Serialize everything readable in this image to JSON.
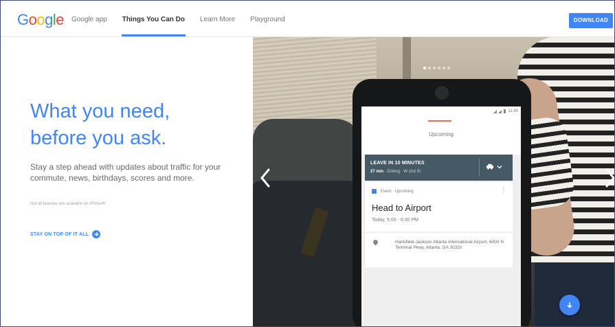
{
  "header": {
    "logo_letters": [
      {
        "char": "G",
        "color": "#4285f4"
      },
      {
        "char": "o",
        "color": "#ea4335"
      },
      {
        "char": "o",
        "color": "#fbbc05"
      },
      {
        "char": "g",
        "color": "#4285f4"
      },
      {
        "char": "l",
        "color": "#34a853"
      },
      {
        "char": "e",
        "color": "#ea4335"
      }
    ],
    "nav": [
      {
        "label": "Google app",
        "active": false
      },
      {
        "label": "Things You Can Do",
        "active": true
      },
      {
        "label": "Learn More",
        "active": false
      },
      {
        "label": "Playground",
        "active": false
      }
    ],
    "download_label": "DOWNLOAD"
  },
  "hero": {
    "headline_line1": "What you need,",
    "headline_line2": "before you ask.",
    "subtext": "Stay a step ahead with updates about traffic for your commute, news, birthdays, scores and more.",
    "footnote": "Not all features are available on iPhone®.",
    "cta_label": "STAY ON TOP OF IT ALL"
  },
  "carousel": {
    "active_index": 0,
    "dot_count": 6
  },
  "phone": {
    "status_time": "11:45",
    "upcoming_label": "Upcoming",
    "leave_title": "LEAVE IN 10 MINUTES",
    "leave_duration": "27 min",
    "leave_mode": " · Driving · W 2nd St",
    "event_meta": "Event · Upcoming",
    "event_title": "Head to Airport",
    "event_time": "Today, 5:00 - 6:00 PM",
    "location": "Hartsfield-Jackson Atlanta International Airport, 6000 N Terminal Pkwy, Atlanta, GA 30320"
  },
  "colors": {
    "accent": "#4285f4",
    "card_header": "#455a64"
  }
}
